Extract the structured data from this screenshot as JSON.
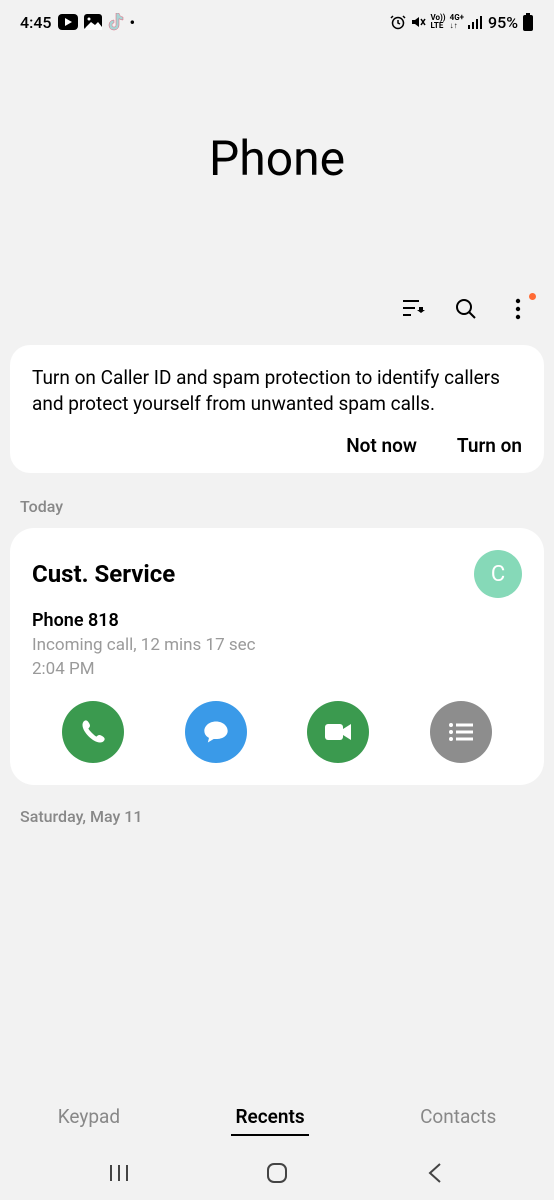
{
  "status_bar": {
    "time": "4:45",
    "battery_text": "95%"
  },
  "page_title": "Phone",
  "banner": {
    "text": "Turn on Caller ID and spam protection to identify callers and protect yourself from unwanted spam calls.",
    "not_now_label": "Not now",
    "turn_on_label": "Turn on"
  },
  "today_label": "Today",
  "call": {
    "name": "Cust. Service",
    "avatar_letter": "C",
    "phone_label": "Phone 818",
    "meta": "Incoming call, 12 mins 17 sec",
    "time": "2:04 PM"
  },
  "next_group_label": "Saturday, May 11",
  "tabs": {
    "keypad": "Keypad",
    "recents": "Recents",
    "contacts": "Contacts"
  }
}
